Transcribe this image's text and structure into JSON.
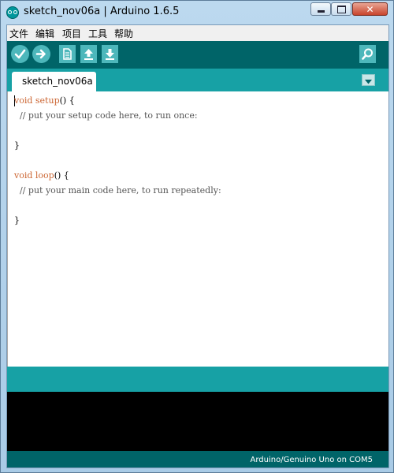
{
  "window": {
    "title": "sketch_nov06a | Arduino 1.6.5"
  },
  "menu": {
    "items": [
      "文件",
      "编辑",
      "项目",
      "工具",
      "帮助"
    ]
  },
  "toolbar": {
    "buttons": [
      {
        "name": "verify",
        "icon": "check-icon"
      },
      {
        "name": "upload",
        "icon": "arrow-right-icon"
      },
      {
        "name": "new",
        "icon": "new-file-icon"
      },
      {
        "name": "open",
        "icon": "arrow-up-icon"
      },
      {
        "name": "save",
        "icon": "arrow-down-icon"
      },
      {
        "name": "serial-monitor",
        "icon": "magnifier-icon"
      }
    ]
  },
  "tabs": [
    {
      "label": "sketch_nov06a"
    }
  ],
  "editor": {
    "lines": [
      "void setup() {",
      "  // put your setup code here, to run once:",
      "",
      "}",
      "",
      "void loop() {",
      "  // put your main code here, to run repeatedly:",
      "",
      "}"
    ]
  },
  "footer": {
    "board": "Arduino/Genuino Uno on COM5"
  },
  "colors": {
    "teal_dark": "#006468",
    "teal_mid": "#17a1a5",
    "teal_light": "#4db7bb",
    "keyword": "#cc6633"
  }
}
